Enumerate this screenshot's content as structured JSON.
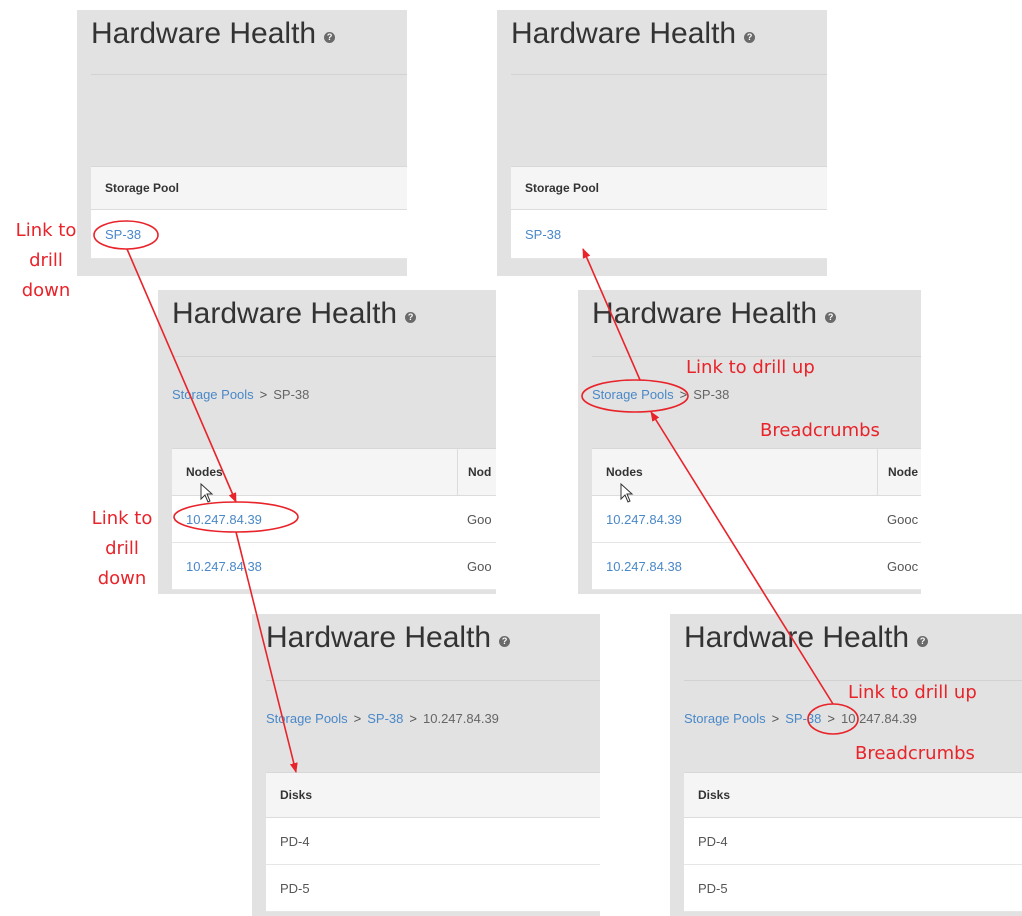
{
  "panels": {
    "p1": {
      "title": "Hardware Health",
      "header": "Storage Pool",
      "rows": [
        "SP-38"
      ]
    },
    "p2": {
      "title": "Hardware Health",
      "header": "Storage Pool",
      "rows": [
        "SP-38"
      ]
    },
    "p3": {
      "title": "Hardware Health",
      "breadcrumb": {
        "link": "Storage Pools",
        "sep": ">",
        "current": "SP-38"
      },
      "headers": [
        "Nodes",
        "Nod"
      ],
      "rows": [
        {
          "node": "10.247.84.39",
          "status": "Goo"
        },
        {
          "node": "10.247.84.38",
          "status": "Goo"
        }
      ]
    },
    "p4": {
      "title": "Hardware Health",
      "breadcrumb": {
        "link": "Storage Pools",
        "sep": ">",
        "current": "SP-38"
      },
      "headers": [
        "Nodes",
        "Node"
      ],
      "rows": [
        {
          "node": "10.247.84.39",
          "status": "Gooc"
        },
        {
          "node": "10.247.84.38",
          "status": "Gooc"
        }
      ]
    },
    "p5": {
      "title": "Hardware Health",
      "breadcrumb": {
        "link1": "Storage Pools",
        "sep1": ">",
        "link2": "SP-38",
        "sep2": ">",
        "current": "10.247.84.39"
      },
      "header": "Disks",
      "rows": [
        "PD-4",
        "PD-5"
      ]
    },
    "p6": {
      "title": "Hardware Health",
      "breadcrumb": {
        "link1": "Storage Pools",
        "sep1": ">",
        "link2": "SP-38",
        "sep2": ">",
        "current": "10.247.84.39"
      },
      "header": "Disks",
      "rows": [
        "PD-4",
        "PD-5"
      ]
    }
  },
  "annotations": {
    "drill_down_1": "Link to\ndrill\ndown",
    "drill_down_2": "Link to\ndrill\ndown",
    "drill_up_1": "Link to drill up",
    "breadcrumbs_1": "Breadcrumbs",
    "drill_up_2": "Link to drill up",
    "breadcrumbs_2": "Breadcrumbs"
  },
  "colors": {
    "annotation": "#e8232a",
    "link": "#4a88c8",
    "panel_bg": "#e2e2e2"
  },
  "icons": {
    "help": "help-circle-icon",
    "cursor": "mouse-pointer-icon"
  }
}
